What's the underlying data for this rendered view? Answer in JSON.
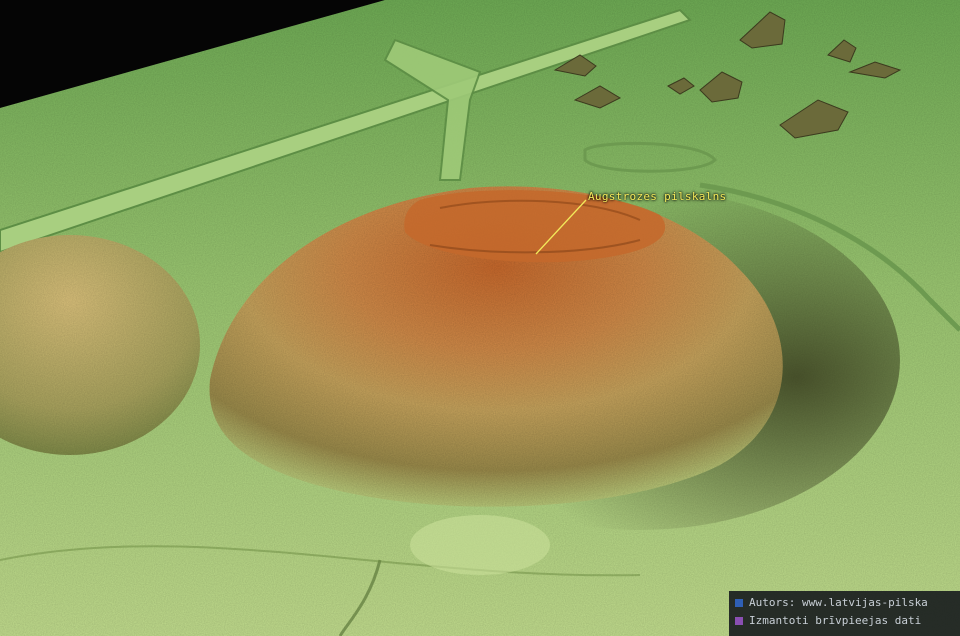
{
  "map": {
    "feature_label": "Augstrozes pilskalns",
    "colors": {
      "low_ground": "#b9d98a",
      "plain": "#8fc26b",
      "upper_plain": "#77b05a",
      "hill_mid": "#d6a863",
      "hill_top": "#c06a2c",
      "label": "#f2e85a"
    }
  },
  "credits": [
    {
      "text": "Autors: www.latvijas-pilska",
      "swatch_color": "#2f5fb4"
    },
    {
      "text": "Izmantoti brīvpieejas dati",
      "swatch_color": "#8a4fb2"
    }
  ]
}
